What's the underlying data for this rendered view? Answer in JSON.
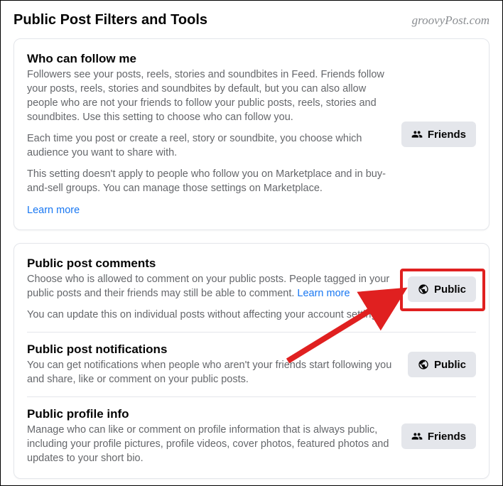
{
  "header": {
    "title": "Public Post Filters and Tools",
    "watermark": "groovyPost.com"
  },
  "follow_card": {
    "title": "Who can follow me",
    "p1": "Followers see your posts, reels, stories and soundbites in Feed. Friends follow your posts, reels, stories and soundbites by default, but you can also allow people who are not your friends to follow your public posts, reels, stories and soundbites. Use this setting to choose who can follow you.",
    "p2": "Each time you post or create a reel, story or soundbite, you choose which audience you want to share with.",
    "p3": "This setting doesn't apply to people who follow you on Marketplace and in buy-and-sell groups. You can manage those settings on Marketplace.",
    "learn": "Learn more",
    "button": "Friends"
  },
  "sections": {
    "comments": {
      "title": "Public post comments",
      "desc": "Choose who is allowed to comment on your public posts. People tagged in your public posts and their friends may still be able to comment. ",
      "learn": "Learn more",
      "sub": "You can update this on individual posts without affecting your account settings.",
      "button": "Public"
    },
    "notifications": {
      "title": "Public post notifications",
      "desc": "You can get notifications when people who aren't your friends start following you and share, like or comment on your public posts.",
      "button": "Public"
    },
    "profile": {
      "title": "Public profile info",
      "desc": "Manage who can like or comment on profile information that is always public, including your profile pictures, profile videos, cover photos, featured photos and updates to your short bio.",
      "button": "Friends"
    }
  }
}
